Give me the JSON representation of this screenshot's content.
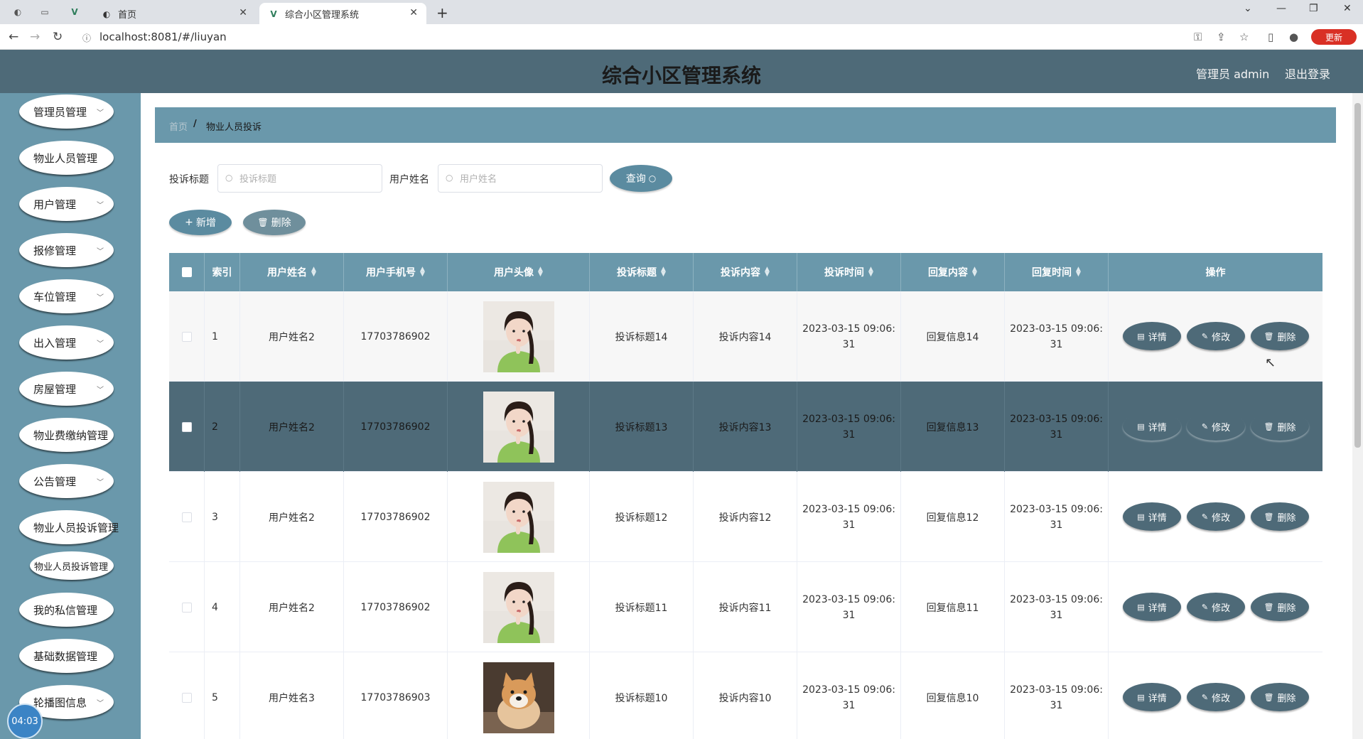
{
  "browser": {
    "tabs": [
      {
        "title": "首页",
        "active": false
      },
      {
        "title": "综合小区管理系统",
        "active": true
      }
    ],
    "url": "localhost:8081/#/liuyan",
    "update_label": "更新"
  },
  "header": {
    "title": "综合小区管理系统",
    "user": "管理员 admin",
    "logout": "退出登录"
  },
  "sidebar": {
    "items": [
      {
        "label": "管理员管理",
        "chevron": true
      },
      {
        "label": "物业人员管理",
        "chevron": false
      },
      {
        "label": "用户管理",
        "chevron": true
      },
      {
        "label": "报修管理",
        "chevron": true
      },
      {
        "label": "车位管理",
        "chevron": true
      },
      {
        "label": "出入管理",
        "chevron": true
      },
      {
        "label": "房屋管理",
        "chevron": true
      },
      {
        "label": "物业费缴纳管理",
        "chevron": false
      },
      {
        "label": "公告管理",
        "chevron": true
      },
      {
        "label": "物业人员投诉管理",
        "chevron": false
      },
      {
        "label": "物业人员投诉管理",
        "chevron": false,
        "sub": true
      },
      {
        "label": "我的私信管理",
        "chevron": false
      },
      {
        "label": "基础数据管理",
        "chevron": false
      },
      {
        "label": "轮播图信息",
        "chevron": true
      }
    ],
    "clock": "04:03"
  },
  "breadcrumb": {
    "home": "首页",
    "separator": "/",
    "current": "物业人员投诉"
  },
  "search": {
    "title_label": "投诉标题",
    "title_placeholder": "投诉标题",
    "name_label": "用户姓名",
    "name_placeholder": "用户姓名",
    "query_button": "查询"
  },
  "actions": {
    "add": "新增",
    "delete": "删除"
  },
  "table": {
    "columns": [
      "索引",
      "用户姓名",
      "用户手机号",
      "用户头像",
      "投诉标题",
      "投诉内容",
      "投诉时间",
      "回复内容",
      "回复时间",
      "操作"
    ],
    "ops": {
      "detail": "详情",
      "edit": "修改",
      "delete": "删除"
    },
    "rows": [
      {
        "index": "1",
        "name": "用户姓名2",
        "phone": "17703786902",
        "avatar": "girl",
        "title": "投诉标题14",
        "content": "投诉内容14",
        "time1": "2023-03-15 09:06:",
        "time2": "31",
        "reply": "回复信息14",
        "rtime1": "2023-03-15 09:06:",
        "rtime2": "31"
      },
      {
        "index": "2",
        "name": "用户姓名2",
        "phone": "17703786902",
        "avatar": "girl",
        "title": "投诉标题13",
        "content": "投诉内容13",
        "time1": "2023-03-15 09:06:",
        "time2": "31",
        "reply": "回复信息13",
        "rtime1": "2023-03-15 09:06:",
        "rtime2": "31"
      },
      {
        "index": "3",
        "name": "用户姓名2",
        "phone": "17703786902",
        "avatar": "girl",
        "title": "投诉标题12",
        "content": "投诉内容12",
        "time1": "2023-03-15 09:06:",
        "time2": "31",
        "reply": "回复信息12",
        "rtime1": "2023-03-15 09:06:",
        "rtime2": "31"
      },
      {
        "index": "4",
        "name": "用户姓名2",
        "phone": "17703786902",
        "avatar": "girl",
        "title": "投诉标题11",
        "content": "投诉内容11",
        "time1": "2023-03-15 09:06:",
        "time2": "31",
        "reply": "回复信息11",
        "rtime1": "2023-03-15 09:06:",
        "rtime2": "31"
      },
      {
        "index": "5",
        "name": "用户姓名3",
        "phone": "17703786903",
        "avatar": "dog",
        "title": "投诉标题10",
        "content": "投诉内容10",
        "time1": "2023-03-15 09:06:",
        "time2": "31",
        "reply": "回复信息10",
        "rtime1": "2023-03-15 09:06:",
        "rtime2": "31"
      }
    ]
  },
  "colors": {
    "header": "#4e6a78",
    "sidebar": "#6a98ab",
    "button": "#4e6a78"
  }
}
